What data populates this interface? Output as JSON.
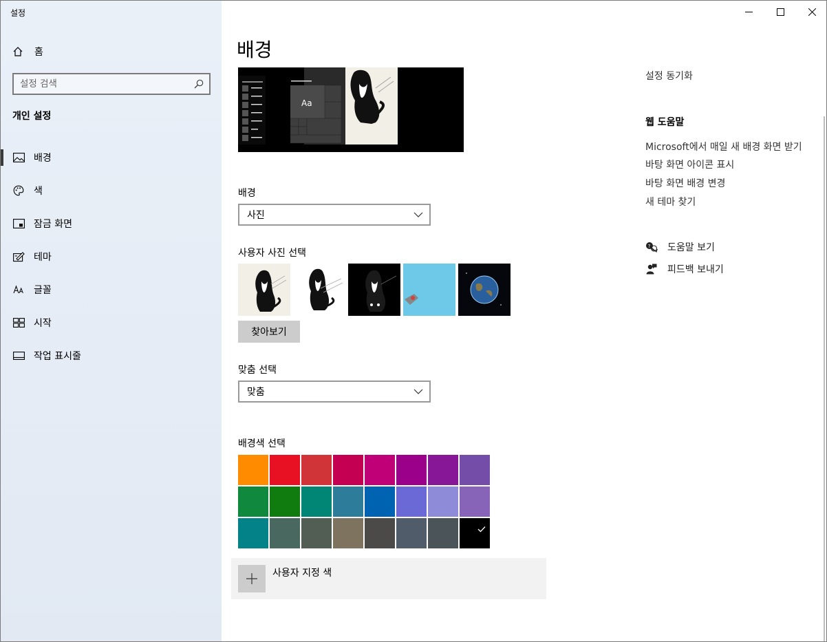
{
  "window": {
    "title": "설정",
    "controls": [
      "minimize-icon",
      "maximize-icon",
      "close-icon"
    ]
  },
  "sidebar": {
    "home_label": "홈",
    "search": {
      "placeholder": "설정 검색",
      "icon": "search-icon"
    },
    "section_title": "개인 설정",
    "items": [
      {
        "label": "배경",
        "icon": "picture-icon",
        "active": true
      },
      {
        "label": "색",
        "icon": "palette-icon",
        "active": false
      },
      {
        "label": "잠금 화면",
        "icon": "lock-screen-icon",
        "active": false
      },
      {
        "label": "테마",
        "icon": "theme-icon",
        "active": false
      },
      {
        "label": "글꼴",
        "icon": "font-icon",
        "active": false
      },
      {
        "label": "시작",
        "icon": "start-icon",
        "active": false
      },
      {
        "label": "작업 표시줄",
        "icon": "taskbar-icon",
        "active": false
      }
    ]
  },
  "main": {
    "title": "배경",
    "preview": {
      "tile_text": "Aa"
    },
    "background": {
      "label": "배경",
      "value": "사진"
    },
    "photos": {
      "label": "사용자 사진 선택",
      "browse_label": "찾아보기"
    },
    "fit": {
      "label": "맞춤 선택",
      "value": "맞춤"
    },
    "colors": {
      "label": "배경색 선택",
      "swatches": [
        "#ff8c00",
        "#e81123",
        "#d13438",
        "#c30052",
        "#bf0077",
        "#9a0089",
        "#881798",
        "#744da9",
        "#10893e",
        "#107c10",
        "#018574",
        "#2d7d9a",
        "#0063b1",
        "#6b69d6",
        "#8e8cd8",
        "#8764b8",
        "#038387",
        "#486860",
        "#525e54",
        "#7e735f",
        "#4c4a48",
        "#515c6b",
        "#4a5459",
        "#000000"
      ],
      "selected_index": 23,
      "custom_label": "사용자 지정 색"
    }
  },
  "right": {
    "sync_label": "설정 동기화",
    "web_help_title": "웹 도움말",
    "links": [
      "Microsoft에서 매일 새 배경 화면 받기",
      "바탕 화면 아이콘 표시",
      "바탕 화면 배경 변경",
      "새 테마 찾기"
    ],
    "get_help_label": "도움말 보기",
    "feedback_label": "피드백 보내기"
  }
}
